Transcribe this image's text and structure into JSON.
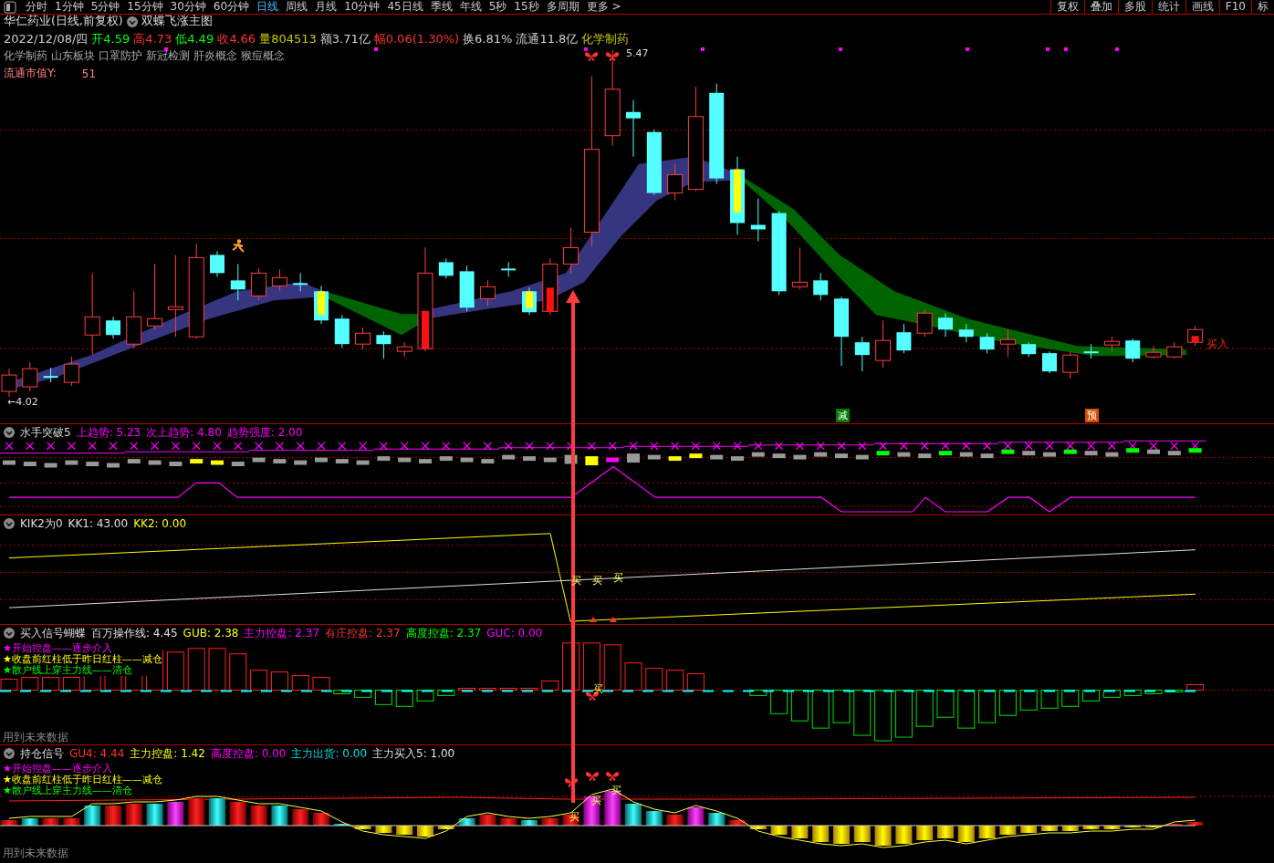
{
  "toolbar": {
    "periods": [
      {
        "label": "分时",
        "selected": false
      },
      {
        "label": "1分钟",
        "selected": false
      },
      {
        "label": "5分钟",
        "selected": false
      },
      {
        "label": "15分钟",
        "selected": false
      },
      {
        "label": "30分钟",
        "selected": false
      },
      {
        "label": "60分钟",
        "selected": false
      },
      {
        "label": "日线",
        "selected": true
      },
      {
        "label": "周线",
        "selected": false
      },
      {
        "label": "月线",
        "selected": false
      },
      {
        "label": "10分钟",
        "selected": false
      },
      {
        "label": "45日线",
        "selected": false
      },
      {
        "label": "季线",
        "selected": false
      },
      {
        "label": "年线",
        "selected": false
      },
      {
        "label": "5秒",
        "selected": false
      },
      {
        "label": "15秒",
        "selected": false
      },
      {
        "label": "多周期",
        "selected": false
      }
    ],
    "more": "更多 >",
    "tools": [
      "复权",
      "叠加",
      "多股",
      "统计",
      "画线",
      "F10",
      "标"
    ]
  },
  "main": {
    "title": "华仁药业(日线,前复权)",
    "indicator": "双蝶飞涨主图",
    "date": "2022/12/08/四",
    "quote": [
      {
        "text": "开4.59",
        "color": "#00ff00"
      },
      {
        "text": "高4.73",
        "color": "#ff3232"
      },
      {
        "text": "低4.49",
        "color": "#00ff00"
      },
      {
        "text": "收4.66",
        "color": "#ff3232"
      },
      {
        "text": "量804513",
        "color": "#c8c800"
      },
      {
        "text": "额3.71亿",
        "color": "#d0d0d0"
      },
      {
        "text": "幅0.06(1.30%)",
        "color": "#ff3232"
      },
      {
        "text": "换6.81%",
        "color": "#d0d0d0"
      },
      {
        "text": "流通11.8亿",
        "color": "#d0d0d0"
      },
      {
        "text": "化学制药",
        "color": "#c8c800"
      }
    ],
    "concepts": [
      "化学制药",
      "山东板块",
      "口罩防护",
      "新冠检测",
      "肝炎概念",
      "猴痘概念"
    ],
    "market_cap": {
      "label": "流通市值Y:",
      "value": "51"
    },
    "low_label": "←4.02",
    "high_label": "5.47",
    "buy_label": "买入",
    "signals": [
      {
        "text": "减",
        "color": "#007a00"
      },
      {
        "text": "预",
        "color": "#d05000"
      }
    ]
  },
  "panels": [
    {
      "title": "水手突破5",
      "values": [
        {
          "text": "上趋势: 5.23",
          "color": "#ff00ff"
        },
        {
          "text": "次上趋势: 4.80",
          "color": "#ff00ff"
        },
        {
          "text": "趋势强度: 2.00",
          "color": "#ff00ff"
        }
      ]
    },
    {
      "title": "KIK2为0",
      "values": [
        {
          "text": "KK1: 43.00",
          "color": "#e0e0e0"
        },
        {
          "text": "KK2: 0.00",
          "color": "#ffff00"
        }
      ],
      "marks": [
        "买",
        "买",
        "买"
      ]
    },
    {
      "title": "买入信号蝴蝶",
      "values": [
        {
          "text": "百万操作线: 4.45",
          "color": "#e0e0e0"
        },
        {
          "text": "GUB: 2.38",
          "color": "#ffff00"
        },
        {
          "text": "主力控盘: 2.37",
          "color": "#ff00ff"
        },
        {
          "text": "有庄控盘: 2.37",
          "color": "#ff3232"
        },
        {
          "text": "高度控盘: 2.37",
          "color": "#00ff00"
        },
        {
          "text": "GUC: 0.00",
          "color": "#ff00ff"
        }
      ],
      "legend": [
        {
          "text": "★开始控盘——逐步介入",
          "color": "#ff00ff"
        },
        {
          "text": "★收盘前红柱低于昨日红柱——减仓",
          "color": "#ffff00"
        },
        {
          "text": "★散户线上穿主力线——清仓",
          "color": "#00ff00"
        }
      ],
      "marks": [
        "买"
      ],
      "footnote": "用到未来数据"
    },
    {
      "title": "持仓信号",
      "values": [
        {
          "text": "GU4: 4.44",
          "color": "#ff3232"
        },
        {
          "text": "主力控盘: 1.42",
          "color": "#ffff00"
        },
        {
          "text": "高度控盘: 0.00",
          "color": "#ff00ff"
        },
        {
          "text": "主力出货: 0.00",
          "color": "#00e0e0"
        },
        {
          "text": "主力买入5: 1.00",
          "color": "#e0e0e0"
        }
      ],
      "legend": [
        {
          "text": "★开始控盘——逐步介入",
          "color": "#ff00ff"
        },
        {
          "text": "★收盘前红柱低于昨日红柱——减仓",
          "color": "#ffff00"
        },
        {
          "text": "★散户线上穿主力线——清仓",
          "color": "#00ff00"
        }
      ],
      "marks": [
        "买",
        "买",
        "买"
      ],
      "footnote": "用到未来数据"
    }
  ]
}
